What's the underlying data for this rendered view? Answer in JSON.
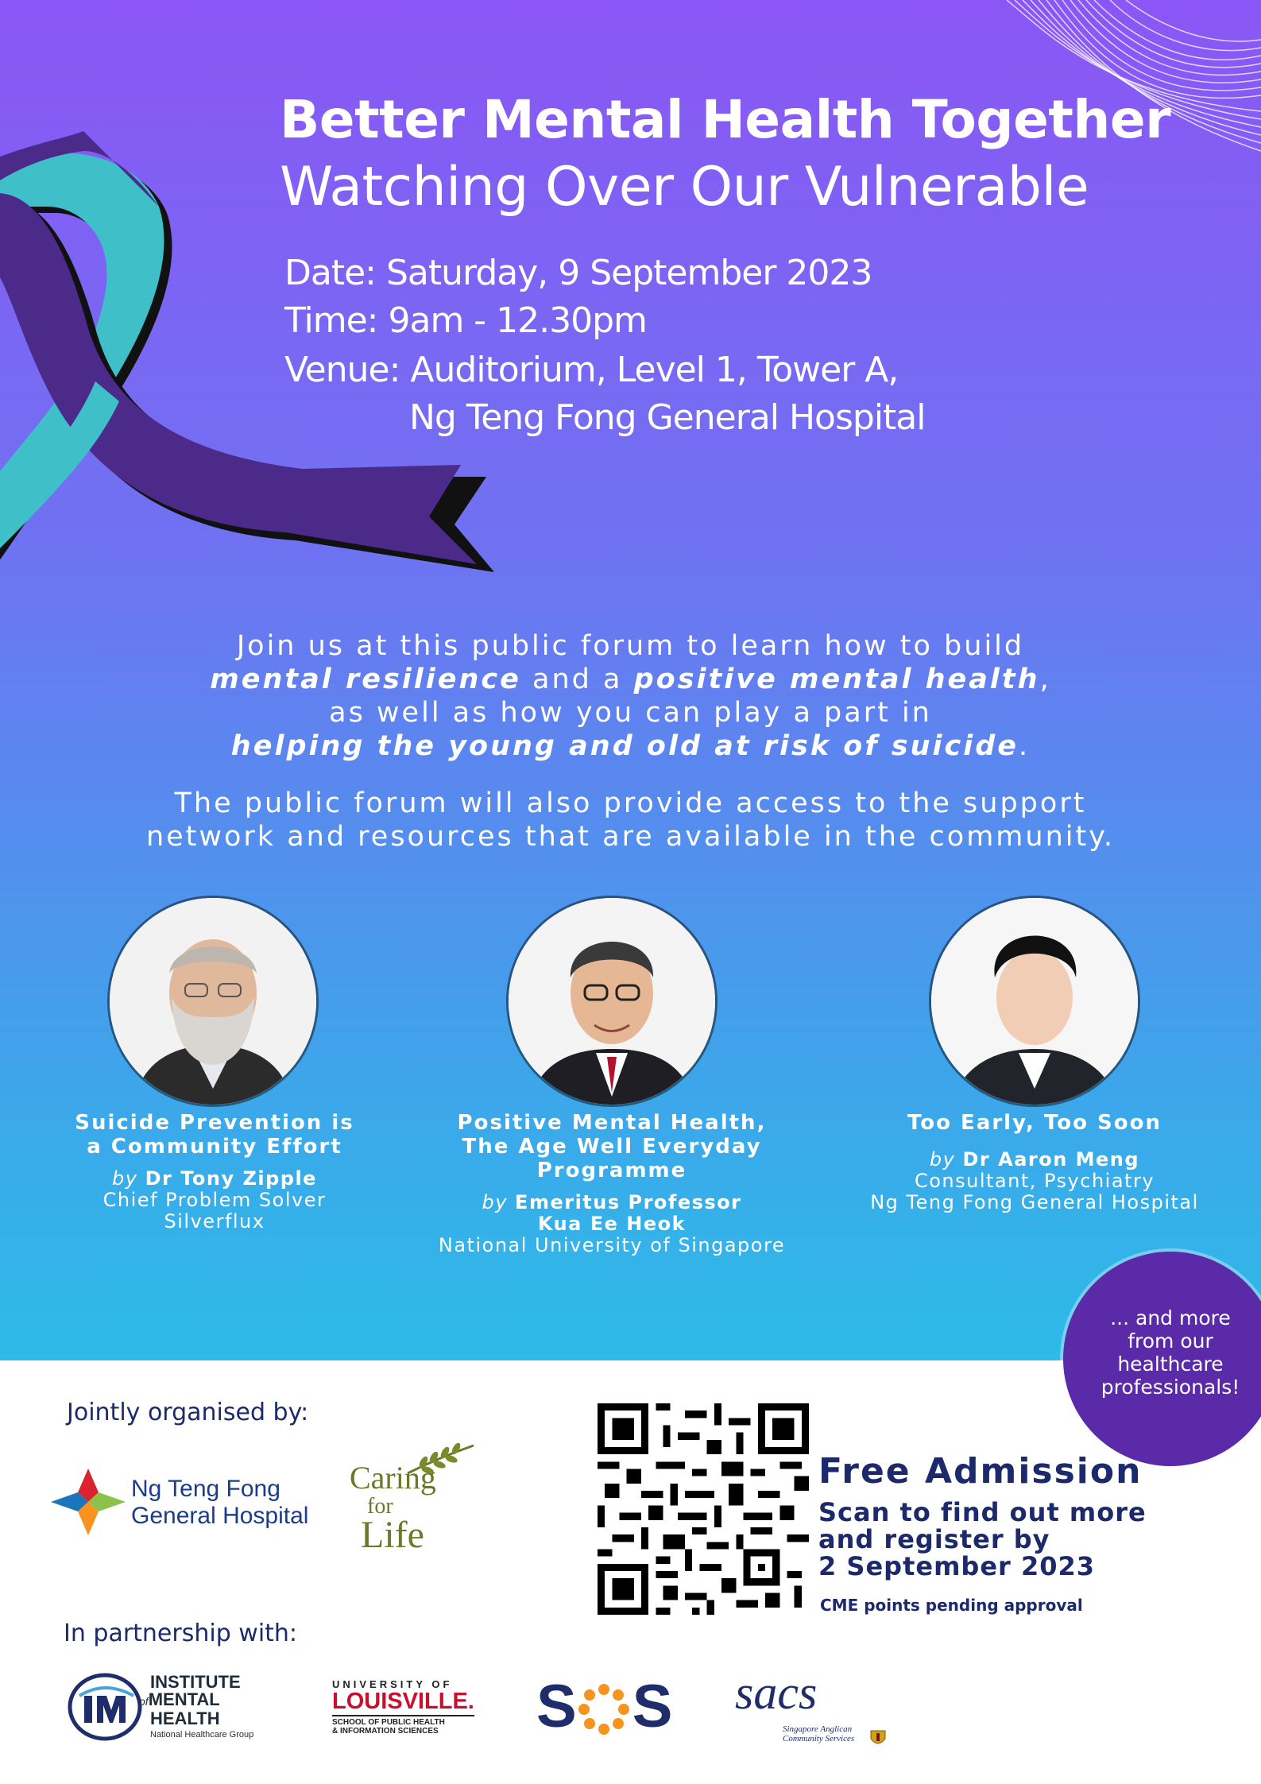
{
  "header": {
    "title_line1": "Better Mental Health Together",
    "title_line2": "Watching Over Our Vulnerable",
    "date": "Date: Saturday, 9 September 2023",
    "time": "Time: 9am - 12.30pm",
    "venue_line1": "Venue: Auditorium, Level 1, Tower A,",
    "venue_line2": "Ng Teng Fong General Hospital"
  },
  "intro": {
    "p1_a": "Join us at this public forum to learn how to build",
    "p1_b1": "mental resilience",
    "p1_b2": " and a ",
    "p1_b3": "positive mental health",
    "p1_b4": ",",
    "p1_c": "as well as how you can play a part in",
    "p1_d": "helping the young and old at risk of suicide",
    "p1_d_end": ".",
    "p2_a": "The public forum will also provide access to the support",
    "p2_b": "network and resources that are available in the community."
  },
  "speakers": [
    {
      "talk_line1": "Suicide Prevention is",
      "talk_line2": "a Community Effort",
      "talk_line3": "",
      "by": "by",
      "name_line1": "Dr Tony Zipple",
      "name_line2": "",
      "role_line1": "Chief Problem Solver",
      "role_line2": "Silverflux"
    },
    {
      "talk_line1": "Positive Mental Health,",
      "talk_line2": "The Age Well Everyday",
      "talk_line3": "Programme",
      "by": "by",
      "name_line1": "Emeritus Professor",
      "name_line2": "Kua Ee Heok",
      "role_line1": "National University of Singapore",
      "role_line2": ""
    },
    {
      "talk_line1": "Too Early, Too Soon",
      "talk_line2": "",
      "talk_line3": "",
      "by": "by",
      "name_line1": "Dr Aaron Meng",
      "name_line2": "",
      "role_line1": "Consultant, Psychiatry",
      "role_line2": "Ng Teng Fong General Hospital"
    }
  ],
  "more": {
    "line1": "... and more",
    "line2": "from our",
    "line3": "healthcare",
    "line4": "professionals!"
  },
  "organisers": {
    "heading": "Jointly organised by:",
    "ntfgh_line1": "Ng Teng Fong",
    "ntfgh_line2": "General Hospital",
    "cfl_line1": "Caring",
    "cfl_line2": "for",
    "cfl_line3": "Life"
  },
  "admission": {
    "title": "Free Admission",
    "line1": "Scan to find out more",
    "line2": "and register by",
    "line3": "2 September 2023",
    "note": "CME points pending approval"
  },
  "partners": {
    "heading": "In partnership with:",
    "imh_line1": "INSTITUTE",
    "imh_of": "of",
    "imh_line2": "MENTAL",
    "imh_line3": "HEALTH",
    "imh_sub": "National Healthcare Group",
    "uol_line1": "UNIVERSITY OF",
    "uol_line2": "LOUISVILLE.",
    "uol_line3": "SCHOOL OF PUBLIC HEALTH",
    "uol_line4": "& INFORMATION SCIENCES",
    "sos_s1": "S",
    "sos_s2": "S",
    "sacs_logo": "sacs",
    "sacs_line1": "Singapore Anglican",
    "sacs_line2": "Community Services"
  },
  "colors": {
    "purple_top": "#8b56f5",
    "blue_bottom": "#2dbbe8",
    "navy_text": "#1c2a6b",
    "circle_purple": "#5b2aa8",
    "ribbon_purple": "#4b2a8a",
    "ribbon_teal": "#3fc0c8"
  },
  "icons": [
    "awareness-ribbon-icon",
    "qr-code-icon",
    "ntfgh-logo-icon",
    "caring-for-life-leaves-icon",
    "imh-logo-icon",
    "sos-sun-icon",
    "sacs-crest-icon"
  ]
}
